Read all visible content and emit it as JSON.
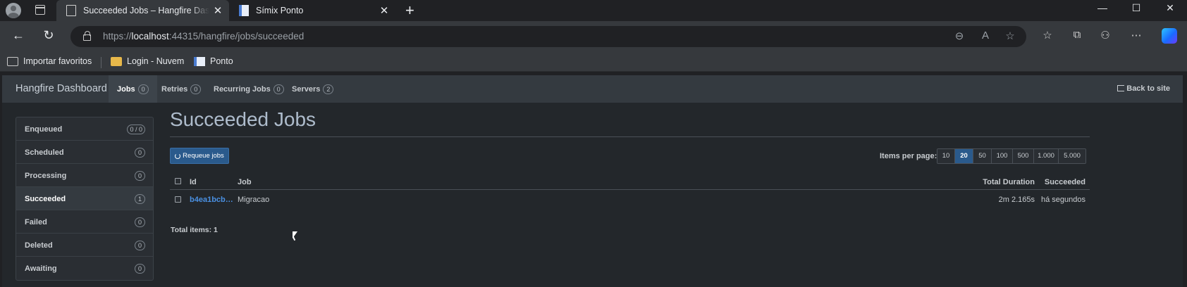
{
  "browser": {
    "tabs": [
      {
        "title": "Succeeded Jobs – Hangfire Dashboard",
        "active": true
      },
      {
        "title": "Símix Ponto",
        "active": false
      }
    ],
    "tab_close": "✕",
    "new_tab": "+",
    "window_controls": {
      "minimize": "—",
      "maximize": "☐",
      "close": "✕"
    },
    "url_prefix": "https://",
    "url_host": "localhost",
    "url_rest": ":44315/hangfire/jobs/succeeded",
    "favorites": [
      {
        "label": "Importar favoritos",
        "icon": "import-icon"
      },
      {
        "label": "Login - Nuvem",
        "icon": "folder-icon"
      },
      {
        "label": "Ponto",
        "icon": "page-icon"
      }
    ]
  },
  "hangfire": {
    "brand": "Hangfire Dashboard",
    "nav": [
      {
        "label": "Jobs",
        "count": "0",
        "active": true
      },
      {
        "label": "Retries",
        "count": "0",
        "active": false
      },
      {
        "label": "Recurring Jobs",
        "count": "0",
        "active": false
      },
      {
        "label": "Servers",
        "count": "2",
        "active": false
      }
    ],
    "back_to_site": "Back to site",
    "sidebar": [
      {
        "label": "Enqueued",
        "count": "0 / 0"
      },
      {
        "label": "Scheduled",
        "count": "0"
      },
      {
        "label": "Processing",
        "count": "0"
      },
      {
        "label": "Succeeded",
        "count": "1"
      },
      {
        "label": "Failed",
        "count": "0"
      },
      {
        "label": "Deleted",
        "count": "0"
      },
      {
        "label": "Awaiting",
        "count": "0"
      }
    ],
    "active_sidebar": "Succeeded",
    "page_title": "Succeeded Jobs",
    "requeue_label": "Requeue jobs",
    "items_per_page_label": "Items per page:",
    "page_sizes": [
      "10",
      "20",
      "50",
      "100",
      "500",
      "1.000",
      "5.000"
    ],
    "selected_page_size": "20",
    "table": {
      "headers": {
        "id": "Id",
        "job": "Job",
        "duration": "Total Duration",
        "succeeded": "Succeeded"
      },
      "rows": [
        {
          "id": "b4ea1bcb…",
          "job": "Migracao",
          "duration": "2m 2.165s",
          "succeeded": "há segundos"
        }
      ]
    },
    "total_items": "Total items: 1"
  }
}
